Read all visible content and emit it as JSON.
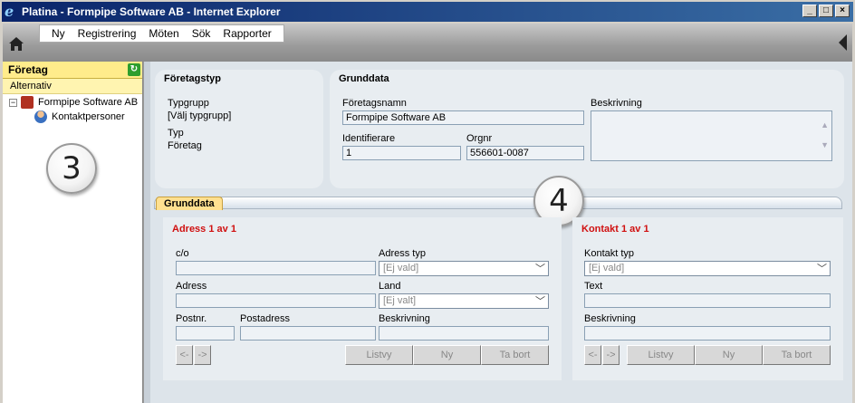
{
  "window": {
    "title": "Platina - Formpipe Software AB - Internet Explorer"
  },
  "menu": [
    "Ny",
    "Registrering",
    "Möten",
    "Sök",
    "Rapporter"
  ],
  "left": {
    "header": "Företag",
    "subheader": "Alternativ",
    "tree": {
      "company": "Formpipe Software AB",
      "child": "Kontaktpersoner"
    },
    "callout": "3"
  },
  "foretagstyp": {
    "title": "Företagstyp",
    "typgrupp_label": "Typgrupp",
    "typgrupp_value": "[Välj typgrupp]",
    "typ_label": "Typ",
    "typ_value": "Företag"
  },
  "grunddata": {
    "title": "Grunddata",
    "foretagsnamn_label": "Företagsnamn",
    "foretagsnamn_value": "Formpipe Software AB",
    "beskrivning_label": "Beskrivning",
    "identifierare_label": "Identifierare",
    "identifierare_value": "1",
    "orgnr_label": "Orgnr",
    "orgnr_value": "556601-0087"
  },
  "callout2": "4",
  "tab": "Grunddata",
  "adress": {
    "title": "Adress 1 av 1",
    "co_label": "c/o",
    "adress_typ_label": "Adress typ",
    "adress_typ_value": "[Ej vald]",
    "adress_label": "Adress",
    "land_label": "Land",
    "land_value": "[Ej valt]",
    "postnr_label": "Postnr.",
    "postadress_label": "Postadress",
    "beskrivning_label": "Beskrivning",
    "prev": "<-",
    "next": "->",
    "listvy": "Listvy",
    "ny": "Ny",
    "ta_bort": "Ta bort"
  },
  "kontakt": {
    "title": "Kontakt 1 av 1",
    "typ_label": "Kontakt typ",
    "typ_value": "[Ej vald]",
    "text_label": "Text",
    "beskrivning_label": "Beskrivning",
    "prev": "<-",
    "next": "->",
    "listvy": "Listvy",
    "ny": "Ny",
    "ta_bort": "Ta bort"
  }
}
